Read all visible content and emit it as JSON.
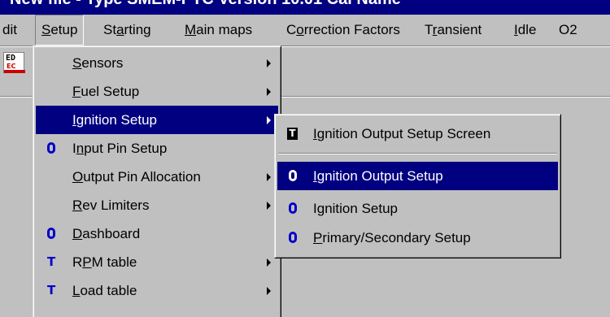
{
  "title_bar": {
    "text": "New file - Type SMEM-PTC Version 10.01 Cal Name"
  },
  "menubar": {
    "items": [
      {
        "label": "dit",
        "ul": "",
        "rest": "dit"
      },
      {
        "label": "Setup",
        "ul": "S",
        "rest": "etup"
      },
      {
        "label": "Starting",
        "pre": "St",
        "ul": "a",
        "rest": "rting"
      },
      {
        "label": "Main maps",
        "ul": "M",
        "rest": "ain maps"
      },
      {
        "label": "Correction Factors",
        "pre": "C",
        "ul": "o",
        "rest": "rrection Factors"
      },
      {
        "label": "Transient",
        "pre": "T",
        "ul": "r",
        "rest": "ansient"
      },
      {
        "label": "Idle",
        "ul": "I",
        "rest": "dle"
      },
      {
        "label": "O2",
        "ul": "",
        "rest": "O2"
      }
    ]
  },
  "toolbar": {
    "icon_top": "ED",
    "icon_bottom": "EC"
  },
  "setup_menu": {
    "items": [
      {
        "ul": "S",
        "rest": "ensors",
        "glyph": "",
        "submenu": true
      },
      {
        "ul": "F",
        "rest": "uel Setup",
        "glyph": "",
        "submenu": true
      },
      {
        "ul": "I",
        "rest": "gnition Setup",
        "glyph": "",
        "submenu": true,
        "selected": true
      },
      {
        "pre": "I",
        "ul": "n",
        "rest": "put Pin Setup",
        "glyph": "O",
        "submenu": false
      },
      {
        "ul": "O",
        "rest": "utput Pin Allocation",
        "glyph": "",
        "submenu": true
      },
      {
        "ul": "R",
        "rest": "ev Limiters",
        "glyph": "",
        "submenu": true
      },
      {
        "ul": "D",
        "rest": "ashboard",
        "glyph": "O",
        "submenu": false
      },
      {
        "pre": "R",
        "ul": "P",
        "rest": "M table",
        "glyph": "T",
        "submenu": true
      },
      {
        "pre": "",
        "ul": "L",
        "rest": "oad table",
        "glyph": "T",
        "submenu": true
      }
    ]
  },
  "ignition_menu": {
    "items": [
      {
        "ul": "I",
        "rest": "gnition Output Setup Screen",
        "glyph": "T"
      },
      {
        "ul": "I",
        "rest": "gnition Output Setup",
        "glyph": "O",
        "selected": true
      },
      {
        "pre": "I",
        "ul": "g",
        "rest": "nition Setup",
        "glyph": "O"
      },
      {
        "ul": "P",
        "rest": "rimary/Secondary Setup",
        "glyph": "O"
      }
    ]
  },
  "colors": {
    "menu_bg": "#c0c0c0",
    "highlight": "#000080",
    "glyph": "#0000c8"
  }
}
